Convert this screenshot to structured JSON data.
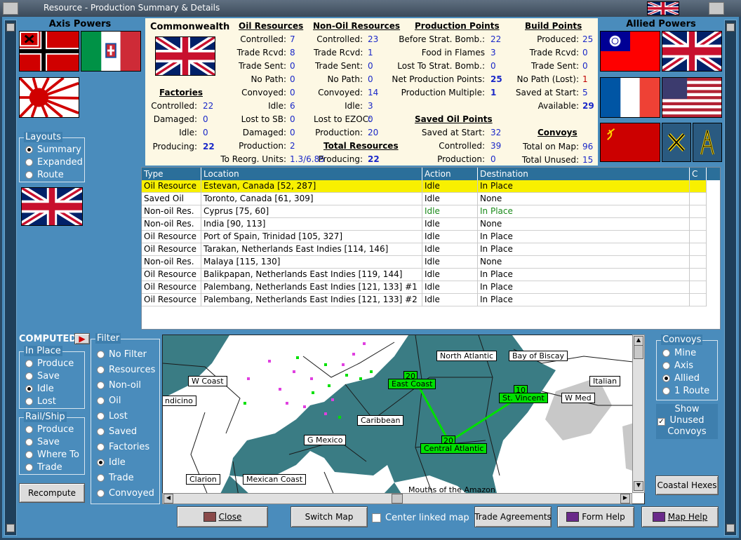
{
  "window": {
    "title": "Resource - Production Summary & Details"
  },
  "axis": {
    "title": "Axis Powers"
  },
  "allied": {
    "title": "Allied Powers"
  },
  "summary": {
    "country": "Commonwealth",
    "oil": {
      "heading": "Oil Resources",
      "rows": [
        {
          "label": "Controlled:",
          "value": "7"
        },
        {
          "label": "Trade Rcvd:",
          "value": "8"
        },
        {
          "label": "Trade Sent:",
          "value": "0"
        },
        {
          "label": "No Path:",
          "value": "0"
        },
        {
          "label": "Convoyed:",
          "value": "0"
        },
        {
          "label": "Idle:",
          "value": "6"
        },
        {
          "label": "Lost to SB:",
          "value": "0"
        },
        {
          "label": "Damaged:",
          "value": "0"
        },
        {
          "label": "Production:",
          "value": "2"
        }
      ],
      "reorg_label": "To Reorg. Units:",
      "reorg_value": "1.3/6.85"
    },
    "nonoil": {
      "heading": "Non-Oil Resources",
      "rows": [
        {
          "label": "Controlled:",
          "value": "23"
        },
        {
          "label": "Trade Rcvd:",
          "value": "1"
        },
        {
          "label": "Trade Sent:",
          "value": "0"
        },
        {
          "label": "No Path:",
          "value": "0"
        },
        {
          "label": "Convoyed:",
          "value": "14"
        },
        {
          "label": "Idle:",
          "value": "3"
        },
        {
          "label": "Lost to EZOC:",
          "value": "0"
        },
        {
          "label": "Production:",
          "value": "20"
        }
      ]
    },
    "total": {
      "heading": "Total Resources",
      "label": "Producing:",
      "value": "22"
    },
    "factories": {
      "heading": "Factories",
      "rows": [
        {
          "label": "Controlled:",
          "value": "22"
        },
        {
          "label": "Damaged:",
          "value": "0"
        },
        {
          "label": "Idle:",
          "value": "0"
        },
        {
          "label": "Producing:",
          "value": "22"
        }
      ]
    },
    "production": {
      "heading": "Production Points",
      "rows": [
        {
          "label": "Before Strat. Bomb.:",
          "value": "22"
        },
        {
          "label": "Food in Flames",
          "value": "3"
        },
        {
          "label": "Lost To Strat. Bomb.:",
          "value": "0"
        },
        {
          "label": "Net Production Points:",
          "value": "25"
        },
        {
          "label": "Production Multiple:",
          "value": "1"
        }
      ]
    },
    "saved_oil": {
      "heading": "Saved Oil Points",
      "rows": [
        {
          "label": "Saved at Start:",
          "value": "32"
        },
        {
          "label": "Controlled:",
          "value": "39"
        },
        {
          "label": "Production:",
          "value": "0"
        }
      ]
    },
    "build": {
      "heading": "Build Points",
      "rows": [
        {
          "label": "Produced:",
          "value": "25"
        },
        {
          "label": "Trade Rcvd:",
          "value": "0"
        },
        {
          "label": "Trade Sent:",
          "value": "0"
        },
        {
          "label": "No Path (Lost):",
          "value": "1"
        },
        {
          "label": "Saved at Start:",
          "value": "5"
        },
        {
          "label": "Available:",
          "value": "29"
        }
      ]
    },
    "convoys": {
      "heading": "Convoys",
      "rows": [
        {
          "label": "Total on Map:",
          "value": "96"
        },
        {
          "label": "Total Unused:",
          "value": "15"
        }
      ]
    }
  },
  "layouts": {
    "legend": "Layouts",
    "options": [
      "Summary",
      "Expanded",
      "Route"
    ],
    "selected": "Summary"
  },
  "computed": {
    "label": "COMPUTED"
  },
  "in_place": {
    "legend": "In Place",
    "options": [
      "Produce",
      "Save",
      "Idle",
      "Lost"
    ],
    "selected": "Idle"
  },
  "rail_ship": {
    "legend": "Rail/Ship",
    "options": [
      "Produce",
      "Save",
      "Where To",
      "Trade"
    ]
  },
  "filter": {
    "legend": "Filter",
    "options": [
      "No Filter",
      "Resources",
      "Non-oil",
      "Oil",
      "Lost",
      "Saved",
      "Factories",
      "Idle",
      "Trade",
      "Convoyed"
    ],
    "selected": "Idle"
  },
  "convoys_box": {
    "legend": "Convoys",
    "options": [
      "Mine",
      "Axis",
      "Allied",
      "1 Route"
    ],
    "selected": "Allied",
    "show_unused_label": "Show Unused Convoys",
    "show_unused_checked": true
  },
  "table": {
    "headers": [
      "Type",
      "Location",
      "Action",
      "Destination",
      "C"
    ],
    "rows": [
      {
        "type": "Oil Resource",
        "location": "Estevan, Canada [52, 287]",
        "action": "Idle",
        "destination": "In Place",
        "selected": true
      },
      {
        "type": "Saved Oil",
        "location": "Toronto, Canada [61, 309]",
        "action": "Idle",
        "destination": "None"
      },
      {
        "type": "Non-oil Res.",
        "location": "Cyprus [75, 60]",
        "action": "Idle",
        "destination": "In Place",
        "green": true
      },
      {
        "type": "Non-oil Res.",
        "location": "India [90, 113]",
        "action": "Idle",
        "destination": "None"
      },
      {
        "type": "Oil Resource",
        "location": "Port of Spain, Trinidad [105, 327]",
        "action": "Idle",
        "destination": "In Place"
      },
      {
        "type": "Oil Resource",
        "location": "Tarakan, Netherlands East Indies [114, 146]",
        "action": "Idle",
        "destination": "In Place"
      },
      {
        "type": "Non-oil Res.",
        "location": "Malaya [115, 130]",
        "action": "Idle",
        "destination": "None"
      },
      {
        "type": "Oil Resource",
        "location": "Balikpapan, Netherlands East Indies [119, 144]",
        "action": "Idle",
        "destination": "In Place"
      },
      {
        "type": "Oil Resource",
        "location": "Palembang, Netherlands East Indies [121, 133] #1",
        "action": "Idle",
        "destination": "In Place"
      },
      {
        "type": "Oil Resource",
        "location": "Palembang, Netherlands East Indies [121, 133] #2",
        "action": "Idle",
        "destination": "In Place"
      }
    ]
  },
  "map": {
    "labels": [
      "North Atlantic",
      "Bay of Biscay",
      "W Coast",
      "East Coast",
      "St. Vincent",
      "W Med",
      "Italian",
      "ndicino",
      "Caribbean",
      "G Mexico",
      "Central Atlantic",
      "Clarion",
      "Mexican Coast",
      "Mouths of the Amazon"
    ],
    "convoy_counts": [
      "20",
      "10",
      "20"
    ]
  },
  "buttons": {
    "recompute": "Recompute",
    "coastal": "Coastal Hexes",
    "close": "Close",
    "switch_map": "Switch Map",
    "center_linked": "Center linked map",
    "trade": "Trade Agreements",
    "form_help": "Form Help",
    "map_help": "Map Help"
  }
}
